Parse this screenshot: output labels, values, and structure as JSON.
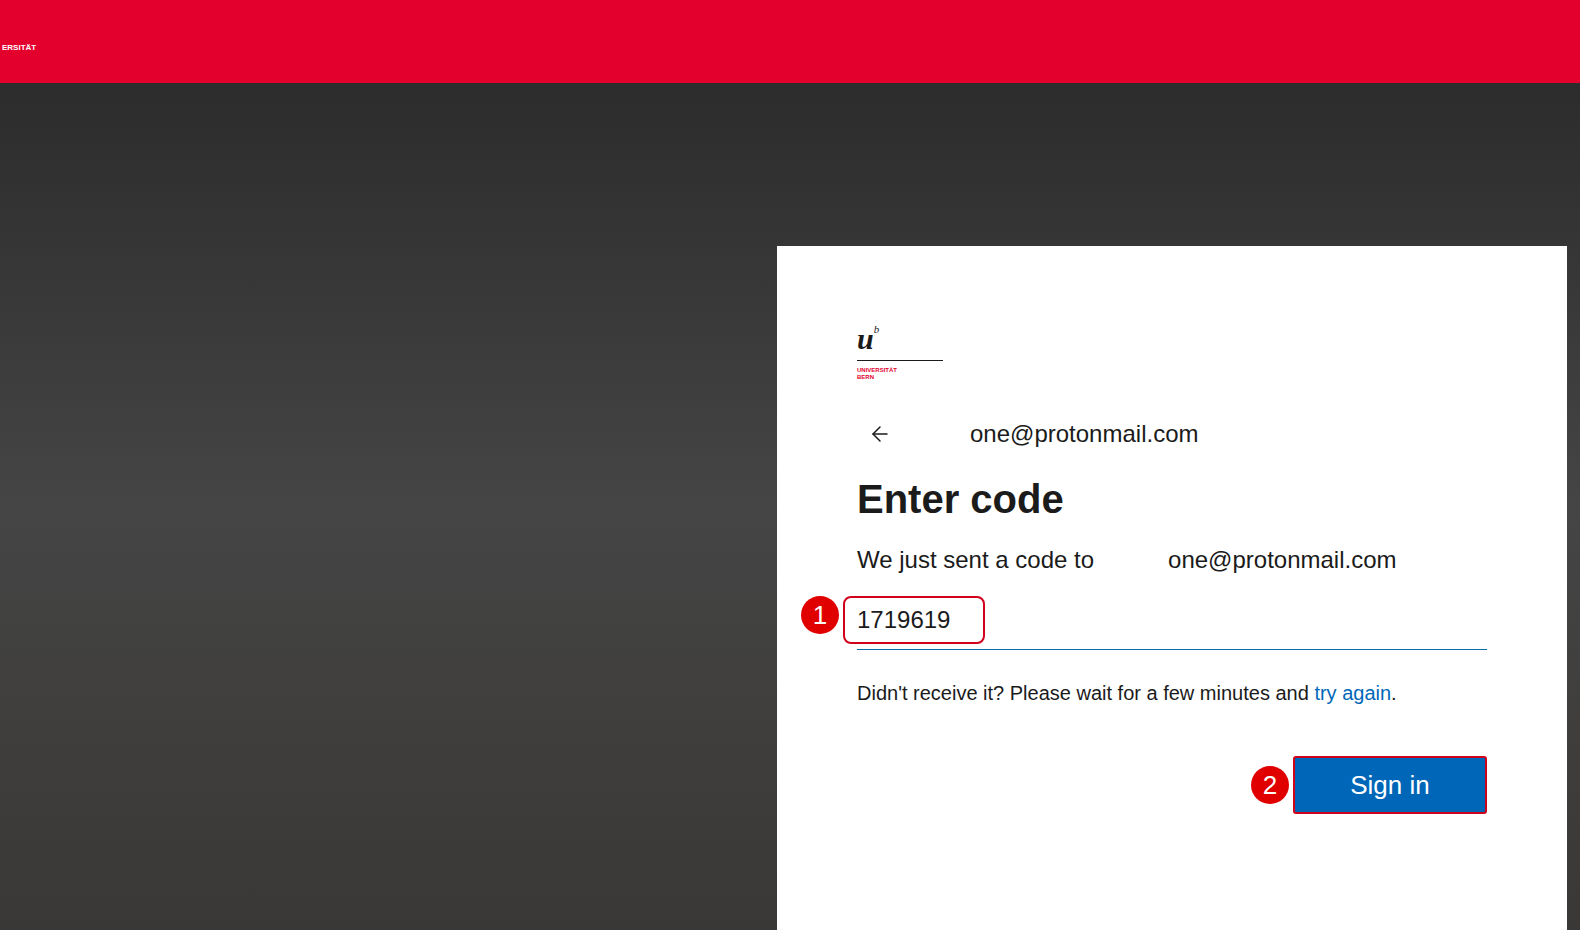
{
  "header": {
    "logo_text": "ERSITÄT"
  },
  "card": {
    "logo": {
      "mark": "u",
      "superscript": "b",
      "name": "UNIVERSITÄT",
      "city": "BERN"
    },
    "account": "one@protonmail.com",
    "title": "Enter code",
    "message": "We just sent a code to",
    "message_email": "one@protonmail.com",
    "code_input": {
      "value": "1719619"
    },
    "help_text": "Didn't receive it? Please wait for a few minutes and",
    "help_link": "try again",
    "help_end": ".",
    "button": "Sign in"
  },
  "annotations": [
    {
      "number": "1",
      "target": "code-input"
    },
    {
      "number": "2",
      "target": "sign-in-button"
    }
  ]
}
